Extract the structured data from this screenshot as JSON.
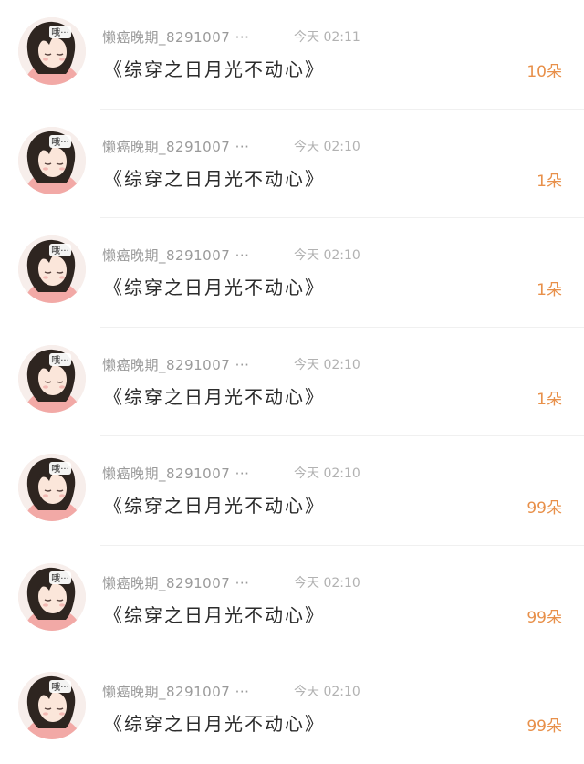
{
  "icons": {
    "avatar": "avatar-anime-girl-icon"
  },
  "colors": {
    "name": "#9a9a9a",
    "time": "#b2b2b2",
    "title": "#2b2b2b",
    "count": "#e8904a",
    "divider": "#f0f0f0"
  },
  "list": {
    "items": [
      {
        "name": "懒癌晚期_8291007 ···",
        "time": "今天 02:11",
        "title": "《综穿之日月光不动心》",
        "count": "10朵",
        "avatar_label": "哦···"
      },
      {
        "name": "懒癌晚期_8291007 ···",
        "time": "今天 02:10",
        "title": "《综穿之日月光不动心》",
        "count": "1朵",
        "avatar_label": "哦···"
      },
      {
        "name": "懒癌晚期_8291007 ···",
        "time": "今天 02:10",
        "title": "《综穿之日月光不动心》",
        "count": "1朵",
        "avatar_label": "哦···"
      },
      {
        "name": "懒癌晚期_8291007 ···",
        "time": "今天 02:10",
        "title": "《综穿之日月光不动心》",
        "count": "1朵",
        "avatar_label": "哦···"
      },
      {
        "name": "懒癌晚期_8291007 ···",
        "time": "今天 02:10",
        "title": "《综穿之日月光不动心》",
        "count": "99朵",
        "avatar_label": "哦···"
      },
      {
        "name": "懒癌晚期_8291007 ···",
        "time": "今天 02:10",
        "title": "《综穿之日月光不动心》",
        "count": "99朵",
        "avatar_label": "哦···"
      },
      {
        "name": "懒癌晚期_8291007 ···",
        "time": "今天 02:10",
        "title": "《综穿之日月光不动心》",
        "count": "99朵",
        "avatar_label": "哦···"
      }
    ]
  }
}
